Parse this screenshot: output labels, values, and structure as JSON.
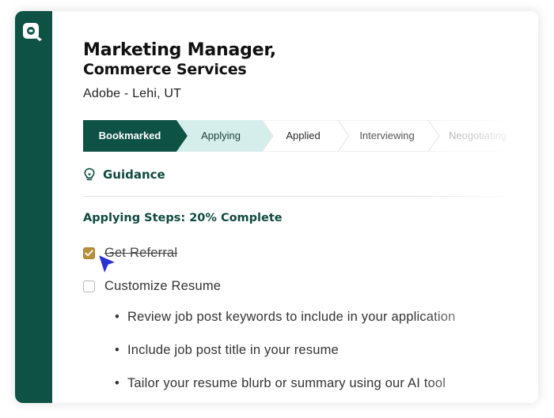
{
  "job": {
    "title_line1": "Marketing Manager,",
    "title_line2": "Commerce Services",
    "company_location": "Adobe - Lehi, UT"
  },
  "stages": [
    {
      "label": "Bookmarked",
      "state": "complete"
    },
    {
      "label": "Applying",
      "state": "current"
    },
    {
      "label": "Applied",
      "state": "upcoming"
    },
    {
      "label": "Interviewing",
      "state": "upcoming"
    },
    {
      "label": "Neogotiating",
      "state": "upcoming"
    }
  ],
  "guidance": {
    "label": "Guidance",
    "icon": "lightbulb-icon"
  },
  "applying_steps": {
    "heading": "Applying Steps: 20% Complete",
    "progress_percent": 20,
    "items": [
      {
        "label": "Get Referral",
        "checked": true
      },
      {
        "label": "Customize Resume",
        "checked": false
      }
    ],
    "sub_items": [
      "Review job post keywords to include in your application",
      "Include job post title in your resume",
      "Tailor your resume blurb or summary using our AI tool"
    ]
  },
  "colors": {
    "brand_green": "#0e5246",
    "stage_current": "#d6eeeb",
    "checkbox_gold": "#b98f3c",
    "cursor_blue": "#2a2fd6"
  }
}
